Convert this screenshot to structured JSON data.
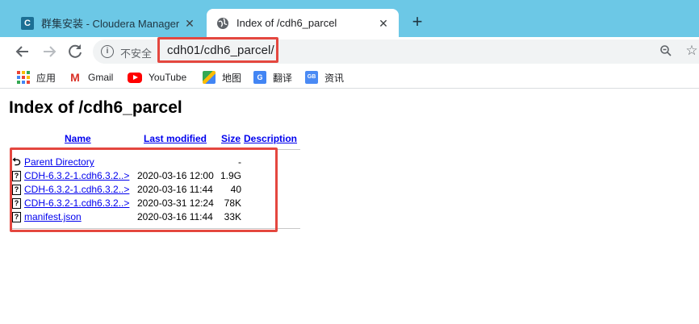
{
  "tabs": [
    {
      "title": "群集安装 - Cloudera Manager",
      "active": false,
      "icon": "cloudera-icon"
    },
    {
      "title": "Index of /cdh6_parcel",
      "active": true,
      "icon": "globe-icon"
    }
  ],
  "new_tab_symbol": "+",
  "omnibox": {
    "security_text": "不安全",
    "url": "cdh01/cdh6_parcel/"
  },
  "bookmarks": [
    {
      "label": "应用",
      "icon": "apps-icon"
    },
    {
      "label": "Gmail",
      "icon": "gmail-icon"
    },
    {
      "label": "YouTube",
      "icon": "youtube-icon"
    },
    {
      "label": "地图",
      "icon": "maps-icon"
    },
    {
      "label": "翻译",
      "icon": "translate-icon"
    },
    {
      "label": "资讯",
      "icon": "news-icon"
    }
  ],
  "page": {
    "heading": "Index of /cdh6_parcel",
    "columns": {
      "name": "Name",
      "modified": "Last modified",
      "size": "Size",
      "description": "Description"
    },
    "rows": [
      {
        "name": "Parent Directory",
        "modified": "",
        "size": "-",
        "icon": "back-icon"
      },
      {
        "name": "CDH-6.3.2-1.cdh6.3.2..>",
        "modified": "2020-03-16 12:00",
        "size": "1.9G",
        "icon": "unknown-file-icon"
      },
      {
        "name": "CDH-6.3.2-1.cdh6.3.2..>",
        "modified": "2020-03-16 11:44",
        "size": "40",
        "icon": "unknown-file-icon"
      },
      {
        "name": "CDH-6.3.2-1.cdh6.3.2..>",
        "modified": "2020-03-31 12:24",
        "size": "78K",
        "icon": "unknown-file-icon"
      },
      {
        "name": "manifest.json",
        "modified": "2020-03-16 11:44",
        "size": "33K",
        "icon": "unknown-file-icon"
      }
    ]
  },
  "colors": {
    "tabstrip": "#6cc8e6",
    "highlight": "#e4473f",
    "link": "#0000ee"
  }
}
